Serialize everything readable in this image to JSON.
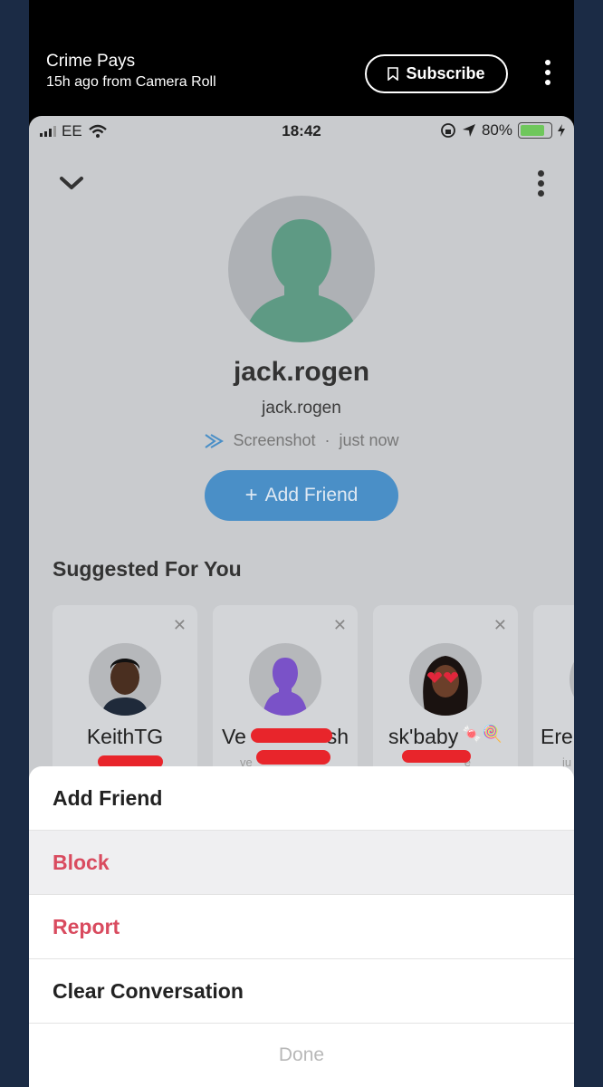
{
  "story": {
    "title": "Crime Pays",
    "subtitle": "15h ago from Camera Roll",
    "subscribe_label": "Subscribe"
  },
  "status_bar": {
    "carrier": "EE",
    "time": "18:42",
    "battery": "80%",
    "battery_level": 0.8
  },
  "profile": {
    "display_name": "jack.rogen",
    "username": "jack.rogen",
    "activity_type": "Screenshot",
    "activity_time": "just now",
    "activity_separator": "·",
    "add_friend_label": "Add Friend"
  },
  "suggested": {
    "title": "Suggested For You",
    "cards": [
      {
        "name": "KeithTG",
        "sub": ""
      },
      {
        "name": "Ve",
        "name_end": "sh",
        "sub": "ve"
      },
      {
        "name": "sk'baby",
        "name_emoji": "🍬🍭",
        "sub": "e"
      },
      {
        "name": "Ere",
        "sub": "ju"
      }
    ]
  },
  "action_sheet": {
    "items": [
      {
        "label": "Add Friend",
        "style": "default"
      },
      {
        "label": "Block",
        "style": "danger"
      },
      {
        "label": "Report",
        "style": "danger"
      },
      {
        "label": "Clear Conversation",
        "style": "default"
      }
    ],
    "done_label": "Done"
  },
  "colors": {
    "accent_blue": "#4a8fc7",
    "danger": "#d94b5f",
    "redaction": "#e8252b",
    "bitmoji_green": "#5e9a84",
    "battery_green": "#6fc75c"
  }
}
